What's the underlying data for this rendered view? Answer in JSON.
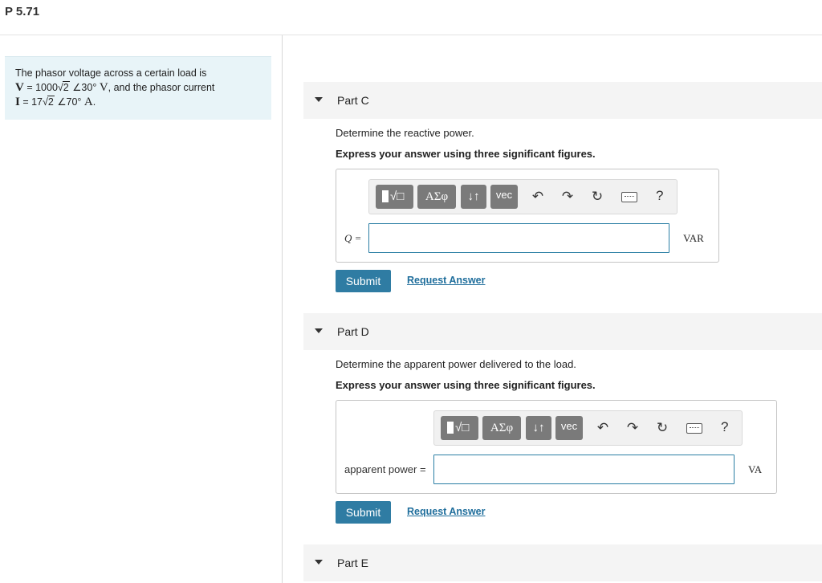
{
  "problem": {
    "id": "P 5.71",
    "statement_line1": "The phasor voltage across a certain load is",
    "voltage": {
      "symbol": "V",
      "equals": " = 1000",
      "radicand": "2",
      "angle": "∠30° ",
      "unit": "V",
      "tail": ", and the phasor current"
    },
    "current": {
      "symbol": "I",
      "equals": " = 17",
      "radicand": "2",
      "angle": "∠70° ",
      "unit": "A",
      "tail": "."
    }
  },
  "toolbar": {
    "templates_icon": "templates-icon",
    "greek_label": "ΑΣφ",
    "arrows_label": "↓↑",
    "vec_label": "vec",
    "undo_glyph": "↶",
    "redo_glyph": "↷",
    "reset_glyph": "↻",
    "help_glyph": "?"
  },
  "parts": [
    {
      "title": "Part C",
      "question": "Determine the reactive power.",
      "instruction": "Express your answer using three significant figures.",
      "answer_label": "Q =",
      "answer_value": "",
      "unit": "VAR",
      "submit_label": "Submit",
      "request_label": "Request Answer"
    },
    {
      "title": "Part D",
      "question": "Determine the apparent power delivered to the load.",
      "instruction": "Express your answer using three significant figures.",
      "answer_label": "apparent power =",
      "answer_value": "",
      "unit": "VA",
      "submit_label": "Submit",
      "request_label": "Request Answer"
    },
    {
      "title": "Part E"
    }
  ]
}
